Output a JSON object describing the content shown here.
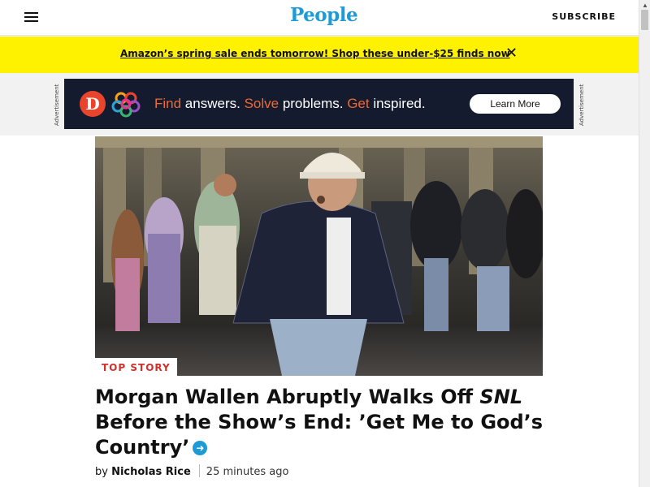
{
  "header": {
    "logo": "People",
    "subscribe_label": "SUBSCRIBE",
    "menu_icon": "hamburger-menu-icon",
    "brand_color": "#1e9bd7"
  },
  "banner": {
    "text": "Amazon’s spring sale ends tomorrow! Shop these under-$25 finds now",
    "close_glyph": "✕",
    "background": "#fff200"
  },
  "ad": {
    "label": "Advertisement",
    "logo_letter": "D",
    "headline_parts": [
      "Find",
      " answers. ",
      "Solve",
      " problems. ",
      "Get",
      " inspired."
    ],
    "cta": "Learn More"
  },
  "story": {
    "tag": "TOP STORY",
    "headline_part1": "Morgan Wallen Abruptly Walks Off ",
    "headline_italic": "SNL",
    "headline_part2": " Before the Show’s End: ’Get Me to God’s Country’",
    "arrow_glyph": "➜",
    "byline_prefix": "by ",
    "author": "Nicholas Rice",
    "time": "25 minutes ago",
    "tag_color": "#d0312d"
  }
}
